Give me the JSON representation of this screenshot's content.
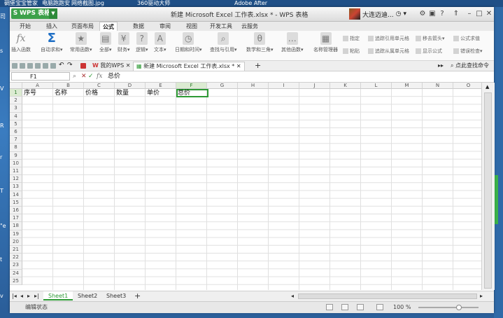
{
  "desktop": {
    "top_items": [
      "碉堡宝宝管家",
      "电脑跑跑安",
      "网络截图.jpg",
      "360驱动大师",
      "Adobe After"
    ],
    "left_fragments": [
      "司",
      "s",
      "V",
      "R",
      "r",
      "T",
      "\"e",
      "t",
      "v"
    ]
  },
  "window": {
    "app_label": "WPS 表格",
    "app_letter": "S",
    "title": "新建 Microsoft Excel 工作表.xlsx * - WPS 表格",
    "user_name": "大连迈迪..."
  },
  "menu_tabs": [
    "开始",
    "插入",
    "页面布局",
    "公式",
    "数据",
    "审阅",
    "视图",
    "开发工具",
    "云服务"
  ],
  "active_menu_tab": "公式",
  "ribbon": {
    "large_buttons": [
      "插入函数",
      "自动求和▾",
      "常用函数▾",
      "全部▾",
      "财务▾",
      "逻辑▾",
      "文本▾",
      "日期和时间▾",
      "查找与引用▾",
      "数学和三角▾",
      "其他函数▾",
      "名称管理器"
    ],
    "small_buttons": [
      "指定",
      "粘贴",
      "追踪引用单元格",
      "追踪从属单元格",
      "移去箭头▾",
      "显示公式",
      "公式求值",
      "错误检查▾"
    ]
  },
  "doc_tabs": {
    "home_label": "我的WPS",
    "file_label": "新建 Microsoft Excel 工作表.xlsx *",
    "find_label": "点此查找命令"
  },
  "formula_bar": {
    "name_box": "F1",
    "fx": "fx",
    "cancel": "✕",
    "confirm": "✓",
    "content": "总价"
  },
  "columns": [
    "A",
    "B",
    "C",
    "D",
    "E",
    "F",
    "G",
    "H",
    "I",
    "J",
    "K",
    "L",
    "M",
    "N",
    "O"
  ],
  "selected_column": "F",
  "rows": [
    "1",
    "2",
    "3",
    "4",
    "5",
    "6",
    "7",
    "8",
    "9",
    "10",
    "11",
    "12",
    "13",
    "14",
    "15",
    "16",
    "17",
    "18",
    "19",
    "20",
    "21",
    "22",
    "23",
    "24",
    "25"
  ],
  "row1_cells": [
    "序号",
    "名称",
    "价格",
    "数量",
    "单价",
    "总价"
  ],
  "sheets": [
    "Sheet1",
    "Sheet2",
    "Sheet3"
  ],
  "active_sheet": "Sheet1",
  "add_sheet": "+",
  "status": {
    "mode": "编辑状态",
    "zoom": "100 %"
  },
  "colors": {
    "accent_green": "#2e9a35",
    "app_green": "#3ca14a"
  }
}
